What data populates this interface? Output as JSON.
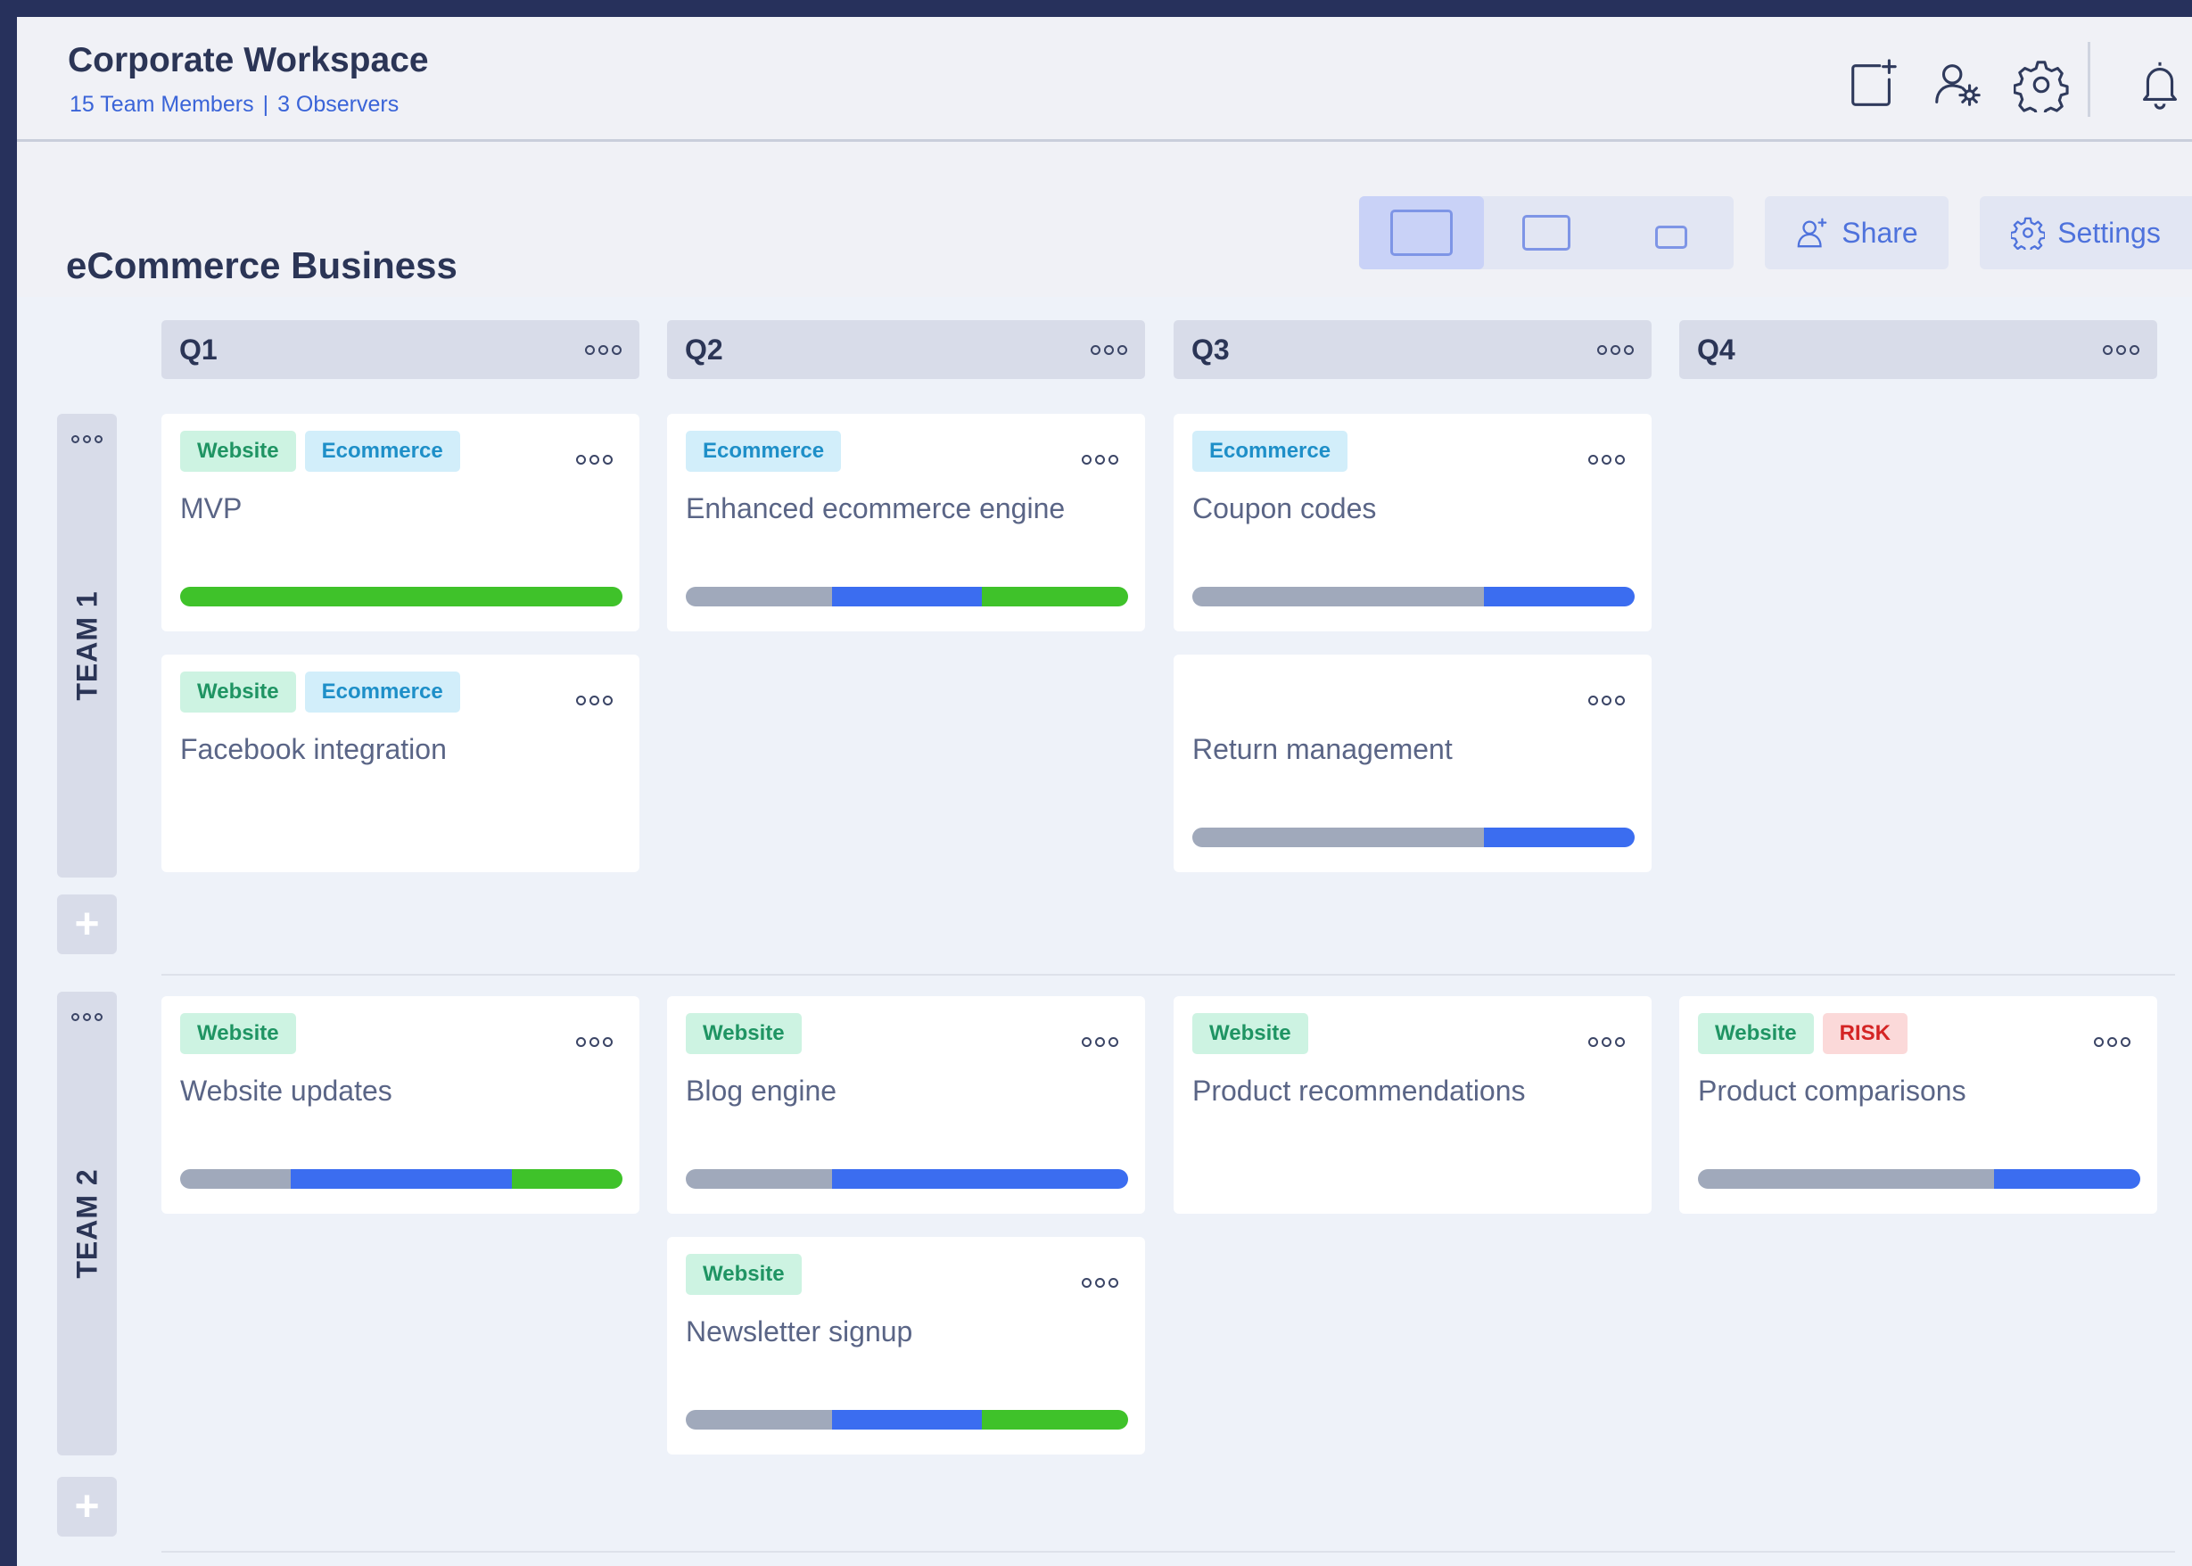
{
  "header": {
    "title": "Corporate Workspace",
    "members": "15 Team Members",
    "separator": "|",
    "observers": "3 Observers",
    "icons": [
      "add-board-icon",
      "user-settings-icon",
      "gear-icon",
      "bell-icon"
    ]
  },
  "board": {
    "title": "eCommerce Business",
    "view_sizes": [
      "large",
      "medium",
      "small"
    ],
    "share_label": "Share",
    "settings_label": "Settings"
  },
  "columns": [
    {
      "label": "Q1"
    },
    {
      "label": "Q2"
    },
    {
      "label": "Q3"
    },
    {
      "label": "Q4"
    }
  ],
  "teams": [
    {
      "label": "TEAM 1"
    },
    {
      "label": "TEAM 2"
    }
  ],
  "cards": [
    {
      "team": 0,
      "col": 0,
      "row": 0,
      "title": "MVP",
      "tags": [
        "Website",
        "Ecommerce"
      ],
      "progress": {
        "grey": 0,
        "blue": 0,
        "green": 1
      }
    },
    {
      "team": 0,
      "col": 1,
      "row": 0,
      "title": "Enhanced ecommerce engine",
      "tags": [
        "Ecommerce"
      ],
      "progress": {
        "grey": 0.33,
        "blue": 0.34,
        "green": 0.33
      }
    },
    {
      "team": 0,
      "col": 2,
      "row": 0,
      "title": "Coupon codes",
      "tags": [
        "Ecommerce"
      ],
      "progress": {
        "grey": 0.66,
        "blue": 0.34,
        "green": 0
      }
    },
    {
      "team": 0,
      "col": 0,
      "row": 1,
      "title": "Facebook integration",
      "tags": [
        "Website",
        "Ecommerce"
      ],
      "progress": null
    },
    {
      "team": 0,
      "col": 2,
      "row": 1,
      "title": "Return management",
      "tags": [],
      "progress": {
        "grey": 0.66,
        "blue": 0.34,
        "green": 0
      }
    },
    {
      "team": 1,
      "col": 0,
      "row": 0,
      "title": "Website updates",
      "tags": [
        "Website"
      ],
      "progress": {
        "grey": 0.25,
        "blue": 0.5,
        "green": 0.25
      }
    },
    {
      "team": 1,
      "col": 1,
      "row": 0,
      "title": "Blog engine",
      "tags": [
        "Website"
      ],
      "progress": {
        "grey": 0.33,
        "blue": 0.67,
        "green": 0
      }
    },
    {
      "team": 1,
      "col": 2,
      "row": 0,
      "title": "Product recommendations",
      "tags": [
        "Website"
      ],
      "progress": null
    },
    {
      "team": 1,
      "col": 3,
      "row": 0,
      "title": "Product comparisons",
      "tags": [
        "Website",
        "RISK"
      ],
      "progress": {
        "grey": 0.67,
        "blue": 0.33,
        "green": 0
      }
    },
    {
      "team": 1,
      "col": 1,
      "row": 1,
      "title": "Newsletter signup",
      "tags": [
        "Website"
      ],
      "progress": {
        "grey": 0.33,
        "blue": 0.34,
        "green": 0.33
      }
    }
  ],
  "colors": {
    "accent": "#3b6df0",
    "progress_grey": "#a0a9bb",
    "progress_blue": "#3b6df0",
    "progress_green": "#3fc22a",
    "tag_website": "#1f9463",
    "tag_ecommerce": "#1e8fc8",
    "tag_risk": "#d42424"
  }
}
